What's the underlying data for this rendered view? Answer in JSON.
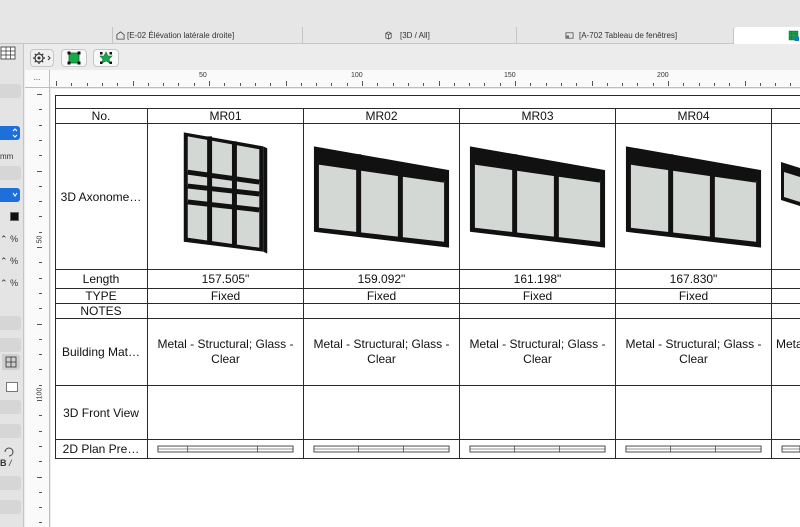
{
  "tabs": [
    {
      "label": "[E-02 Élévation latérale droite]",
      "icon": "house-elevation-icon"
    },
    {
      "label": "[3D / All]",
      "icon": "cube-3d-icon"
    },
    {
      "label": "[A-702 Tableau de fenêtres]",
      "icon": "schedule-icon"
    },
    {
      "label": "",
      "icon": "active-view-icon"
    }
  ],
  "left_palette": {
    "mm_label": "mm",
    "percent_labels": [
      "%",
      "%",
      "%"
    ],
    "b_label": "B"
  },
  "ruler": {
    "corner_label": "...",
    "h_marks": [
      "50",
      "100",
      "150",
      "200"
    ],
    "v_marks": [
      "50",
      "100"
    ]
  },
  "table": {
    "row_headers": [
      "No.",
      "3D Axonome…",
      "Length",
      "TYPE",
      "NOTES",
      "Building Mat…",
      "3D Front View",
      "2D Plan Pre…"
    ],
    "columns": [
      {
        "id": "MR01",
        "length": "157.505\"",
        "type": "Fixed",
        "notes": "",
        "material": "Metal - Structural; Glass - Clear",
        "front_view": ""
      },
      {
        "id": "MR02",
        "length": "159.092\"",
        "type": "Fixed",
        "notes": "",
        "material": "Metal - Structural; Glass - Clear",
        "front_view": ""
      },
      {
        "id": "MR03",
        "length": "161.198\"",
        "type": "Fixed",
        "notes": "",
        "material": "Metal - Structural; Glass - Clear",
        "front_view": ""
      },
      {
        "id": "MR04",
        "length": "167.830\"",
        "type": "Fixed",
        "notes": "",
        "material": "Metal - Structural; Glass - Clear",
        "front_view": ""
      },
      {
        "id": "",
        "length": "",
        "type": "",
        "notes": "",
        "material": "Metal",
        "front_view": ""
      }
    ]
  },
  "colors": {
    "accent": "#1e6fd9",
    "toolbar_green": "#1aa84a",
    "glass": "#d4d8d4",
    "frame": "#111111"
  }
}
